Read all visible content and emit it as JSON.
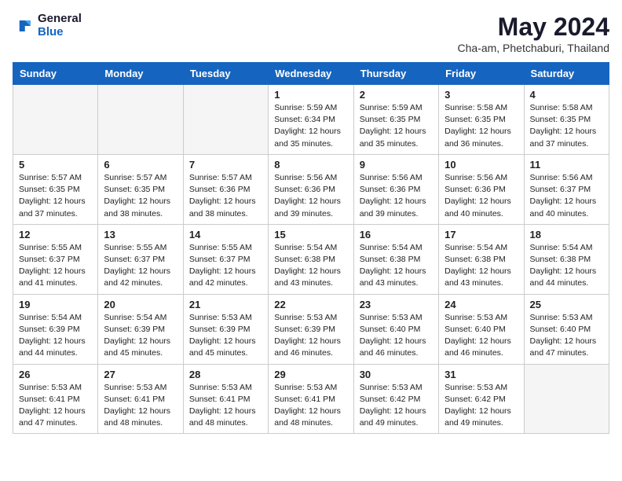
{
  "header": {
    "logo_general": "General",
    "logo_blue": "Blue",
    "month_year": "May 2024",
    "location": "Cha-am, Phetchaburi, Thailand"
  },
  "weekdays": [
    "Sunday",
    "Monday",
    "Tuesday",
    "Wednesday",
    "Thursday",
    "Friday",
    "Saturday"
  ],
  "weeks": [
    [
      {
        "day": "",
        "info": ""
      },
      {
        "day": "",
        "info": ""
      },
      {
        "day": "",
        "info": ""
      },
      {
        "day": "1",
        "info": "Sunrise: 5:59 AM\nSunset: 6:34 PM\nDaylight: 12 hours\nand 35 minutes."
      },
      {
        "day": "2",
        "info": "Sunrise: 5:59 AM\nSunset: 6:35 PM\nDaylight: 12 hours\nand 35 minutes."
      },
      {
        "day": "3",
        "info": "Sunrise: 5:58 AM\nSunset: 6:35 PM\nDaylight: 12 hours\nand 36 minutes."
      },
      {
        "day": "4",
        "info": "Sunrise: 5:58 AM\nSunset: 6:35 PM\nDaylight: 12 hours\nand 37 minutes."
      }
    ],
    [
      {
        "day": "5",
        "info": "Sunrise: 5:57 AM\nSunset: 6:35 PM\nDaylight: 12 hours\nand 37 minutes."
      },
      {
        "day": "6",
        "info": "Sunrise: 5:57 AM\nSunset: 6:35 PM\nDaylight: 12 hours\nand 38 minutes."
      },
      {
        "day": "7",
        "info": "Sunrise: 5:57 AM\nSunset: 6:36 PM\nDaylight: 12 hours\nand 38 minutes."
      },
      {
        "day": "8",
        "info": "Sunrise: 5:56 AM\nSunset: 6:36 PM\nDaylight: 12 hours\nand 39 minutes."
      },
      {
        "day": "9",
        "info": "Sunrise: 5:56 AM\nSunset: 6:36 PM\nDaylight: 12 hours\nand 39 minutes."
      },
      {
        "day": "10",
        "info": "Sunrise: 5:56 AM\nSunset: 6:36 PM\nDaylight: 12 hours\nand 40 minutes."
      },
      {
        "day": "11",
        "info": "Sunrise: 5:56 AM\nSunset: 6:37 PM\nDaylight: 12 hours\nand 40 minutes."
      }
    ],
    [
      {
        "day": "12",
        "info": "Sunrise: 5:55 AM\nSunset: 6:37 PM\nDaylight: 12 hours\nand 41 minutes."
      },
      {
        "day": "13",
        "info": "Sunrise: 5:55 AM\nSunset: 6:37 PM\nDaylight: 12 hours\nand 42 minutes."
      },
      {
        "day": "14",
        "info": "Sunrise: 5:55 AM\nSunset: 6:37 PM\nDaylight: 12 hours\nand 42 minutes."
      },
      {
        "day": "15",
        "info": "Sunrise: 5:54 AM\nSunset: 6:38 PM\nDaylight: 12 hours\nand 43 minutes."
      },
      {
        "day": "16",
        "info": "Sunrise: 5:54 AM\nSunset: 6:38 PM\nDaylight: 12 hours\nand 43 minutes."
      },
      {
        "day": "17",
        "info": "Sunrise: 5:54 AM\nSunset: 6:38 PM\nDaylight: 12 hours\nand 43 minutes."
      },
      {
        "day": "18",
        "info": "Sunrise: 5:54 AM\nSunset: 6:38 PM\nDaylight: 12 hours\nand 44 minutes."
      }
    ],
    [
      {
        "day": "19",
        "info": "Sunrise: 5:54 AM\nSunset: 6:39 PM\nDaylight: 12 hours\nand 44 minutes."
      },
      {
        "day": "20",
        "info": "Sunrise: 5:54 AM\nSunset: 6:39 PM\nDaylight: 12 hours\nand 45 minutes."
      },
      {
        "day": "21",
        "info": "Sunrise: 5:53 AM\nSunset: 6:39 PM\nDaylight: 12 hours\nand 45 minutes."
      },
      {
        "day": "22",
        "info": "Sunrise: 5:53 AM\nSunset: 6:39 PM\nDaylight: 12 hours\nand 46 minutes."
      },
      {
        "day": "23",
        "info": "Sunrise: 5:53 AM\nSunset: 6:40 PM\nDaylight: 12 hours\nand 46 minutes."
      },
      {
        "day": "24",
        "info": "Sunrise: 5:53 AM\nSunset: 6:40 PM\nDaylight: 12 hours\nand 46 minutes."
      },
      {
        "day": "25",
        "info": "Sunrise: 5:53 AM\nSunset: 6:40 PM\nDaylight: 12 hours\nand 47 minutes."
      }
    ],
    [
      {
        "day": "26",
        "info": "Sunrise: 5:53 AM\nSunset: 6:41 PM\nDaylight: 12 hours\nand 47 minutes."
      },
      {
        "day": "27",
        "info": "Sunrise: 5:53 AM\nSunset: 6:41 PM\nDaylight: 12 hours\nand 48 minutes."
      },
      {
        "day": "28",
        "info": "Sunrise: 5:53 AM\nSunset: 6:41 PM\nDaylight: 12 hours\nand 48 minutes."
      },
      {
        "day": "29",
        "info": "Sunrise: 5:53 AM\nSunset: 6:41 PM\nDaylight: 12 hours\nand 48 minutes."
      },
      {
        "day": "30",
        "info": "Sunrise: 5:53 AM\nSunset: 6:42 PM\nDaylight: 12 hours\nand 49 minutes."
      },
      {
        "day": "31",
        "info": "Sunrise: 5:53 AM\nSunset: 6:42 PM\nDaylight: 12 hours\nand 49 minutes."
      },
      {
        "day": "",
        "info": ""
      }
    ]
  ]
}
